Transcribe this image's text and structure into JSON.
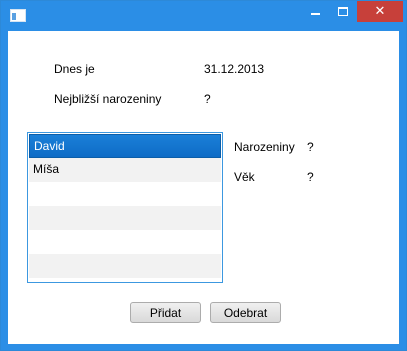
{
  "window": {
    "title": "",
    "controls": {
      "minimize": "minimize",
      "maximize": "maximize",
      "close": "✕"
    }
  },
  "info": {
    "today_label": "Dnes je",
    "today_value": "31.12.2013",
    "nearest_label": "Nejbližší narozeniny",
    "nearest_value": "?"
  },
  "people_list": {
    "items": [
      "David",
      "Míša"
    ],
    "selected": "David"
  },
  "details": {
    "birthday_label": "Narozeniny",
    "birthday_value": "?",
    "age_label": "Věk",
    "age_value": "?"
  },
  "buttons": {
    "add": "Přidat",
    "remove": "Odebrat"
  },
  "colors": {
    "titlebar": "#2b8ee6",
    "close": "#c7403a",
    "selection": "#1575d0"
  }
}
